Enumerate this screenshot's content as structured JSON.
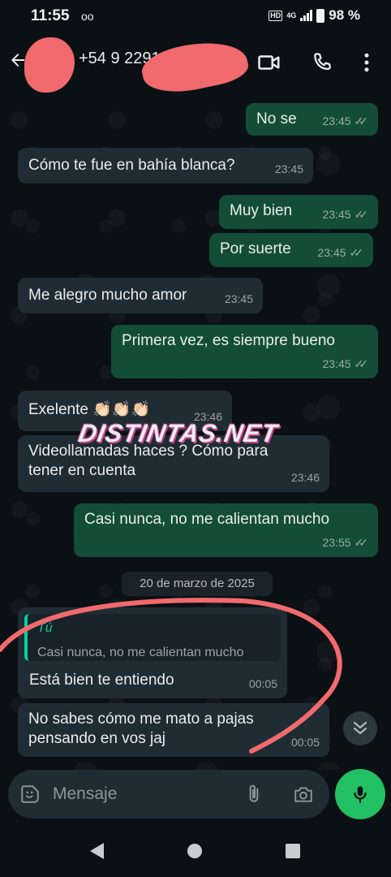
{
  "status_bar": {
    "time": "11:55",
    "voicemail_icon": "voicemail-icon",
    "hd": "HD",
    "network": "4G",
    "battery": "98 %"
  },
  "header": {
    "contact": "+54 9 2291"
  },
  "messages": [
    {
      "dir": "out",
      "text": "No se",
      "time": "23:45",
      "ticks": "✓✓"
    },
    {
      "dir": "in",
      "text": "Cómo te fue en bahía blanca?",
      "time": "23:45"
    },
    {
      "dir": "out",
      "text": "Muy bien",
      "time": "23:45",
      "ticks": "✓✓"
    },
    {
      "dir": "out",
      "text": "Por suerte",
      "time": "23:45",
      "ticks": "✓✓"
    },
    {
      "dir": "in",
      "text": "Me alegro mucho amor",
      "time": "23:45"
    },
    {
      "dir": "out",
      "text": "Primera vez, es siempre bueno",
      "time": "23:45",
      "ticks": "✓✓"
    },
    {
      "dir": "in",
      "text": "Exelente 👏🏻👏🏻👏🏻",
      "time": "23:46"
    },
    {
      "dir": "in",
      "text": "Videollamadas haces ? Cómo para tener en cuenta",
      "time": "23:46"
    },
    {
      "dir": "out",
      "text": "Casi nunca, no me calientan mucho",
      "time": "23:55",
      "ticks": "✓✓"
    },
    {
      "dir": "in",
      "text": "Está bien te entiendo",
      "time": "00:05",
      "quote": {
        "author": "Tú",
        "text": "Casi nunca, no me calientan mucho"
      }
    },
    {
      "dir": "in",
      "text": "No sabes cómo me mato a pajas pensando en vos jaj",
      "time": "00:05"
    }
  ],
  "date_separator": "20 de marzo de 2025",
  "watermark": "DISTINTAS.NET",
  "composer": {
    "placeholder": "Mensaje"
  },
  "colors": {
    "outgoing": "#144d37",
    "incoming": "#1f2c34",
    "accent": "#21c063",
    "quote_bar": "#06cf9c"
  }
}
